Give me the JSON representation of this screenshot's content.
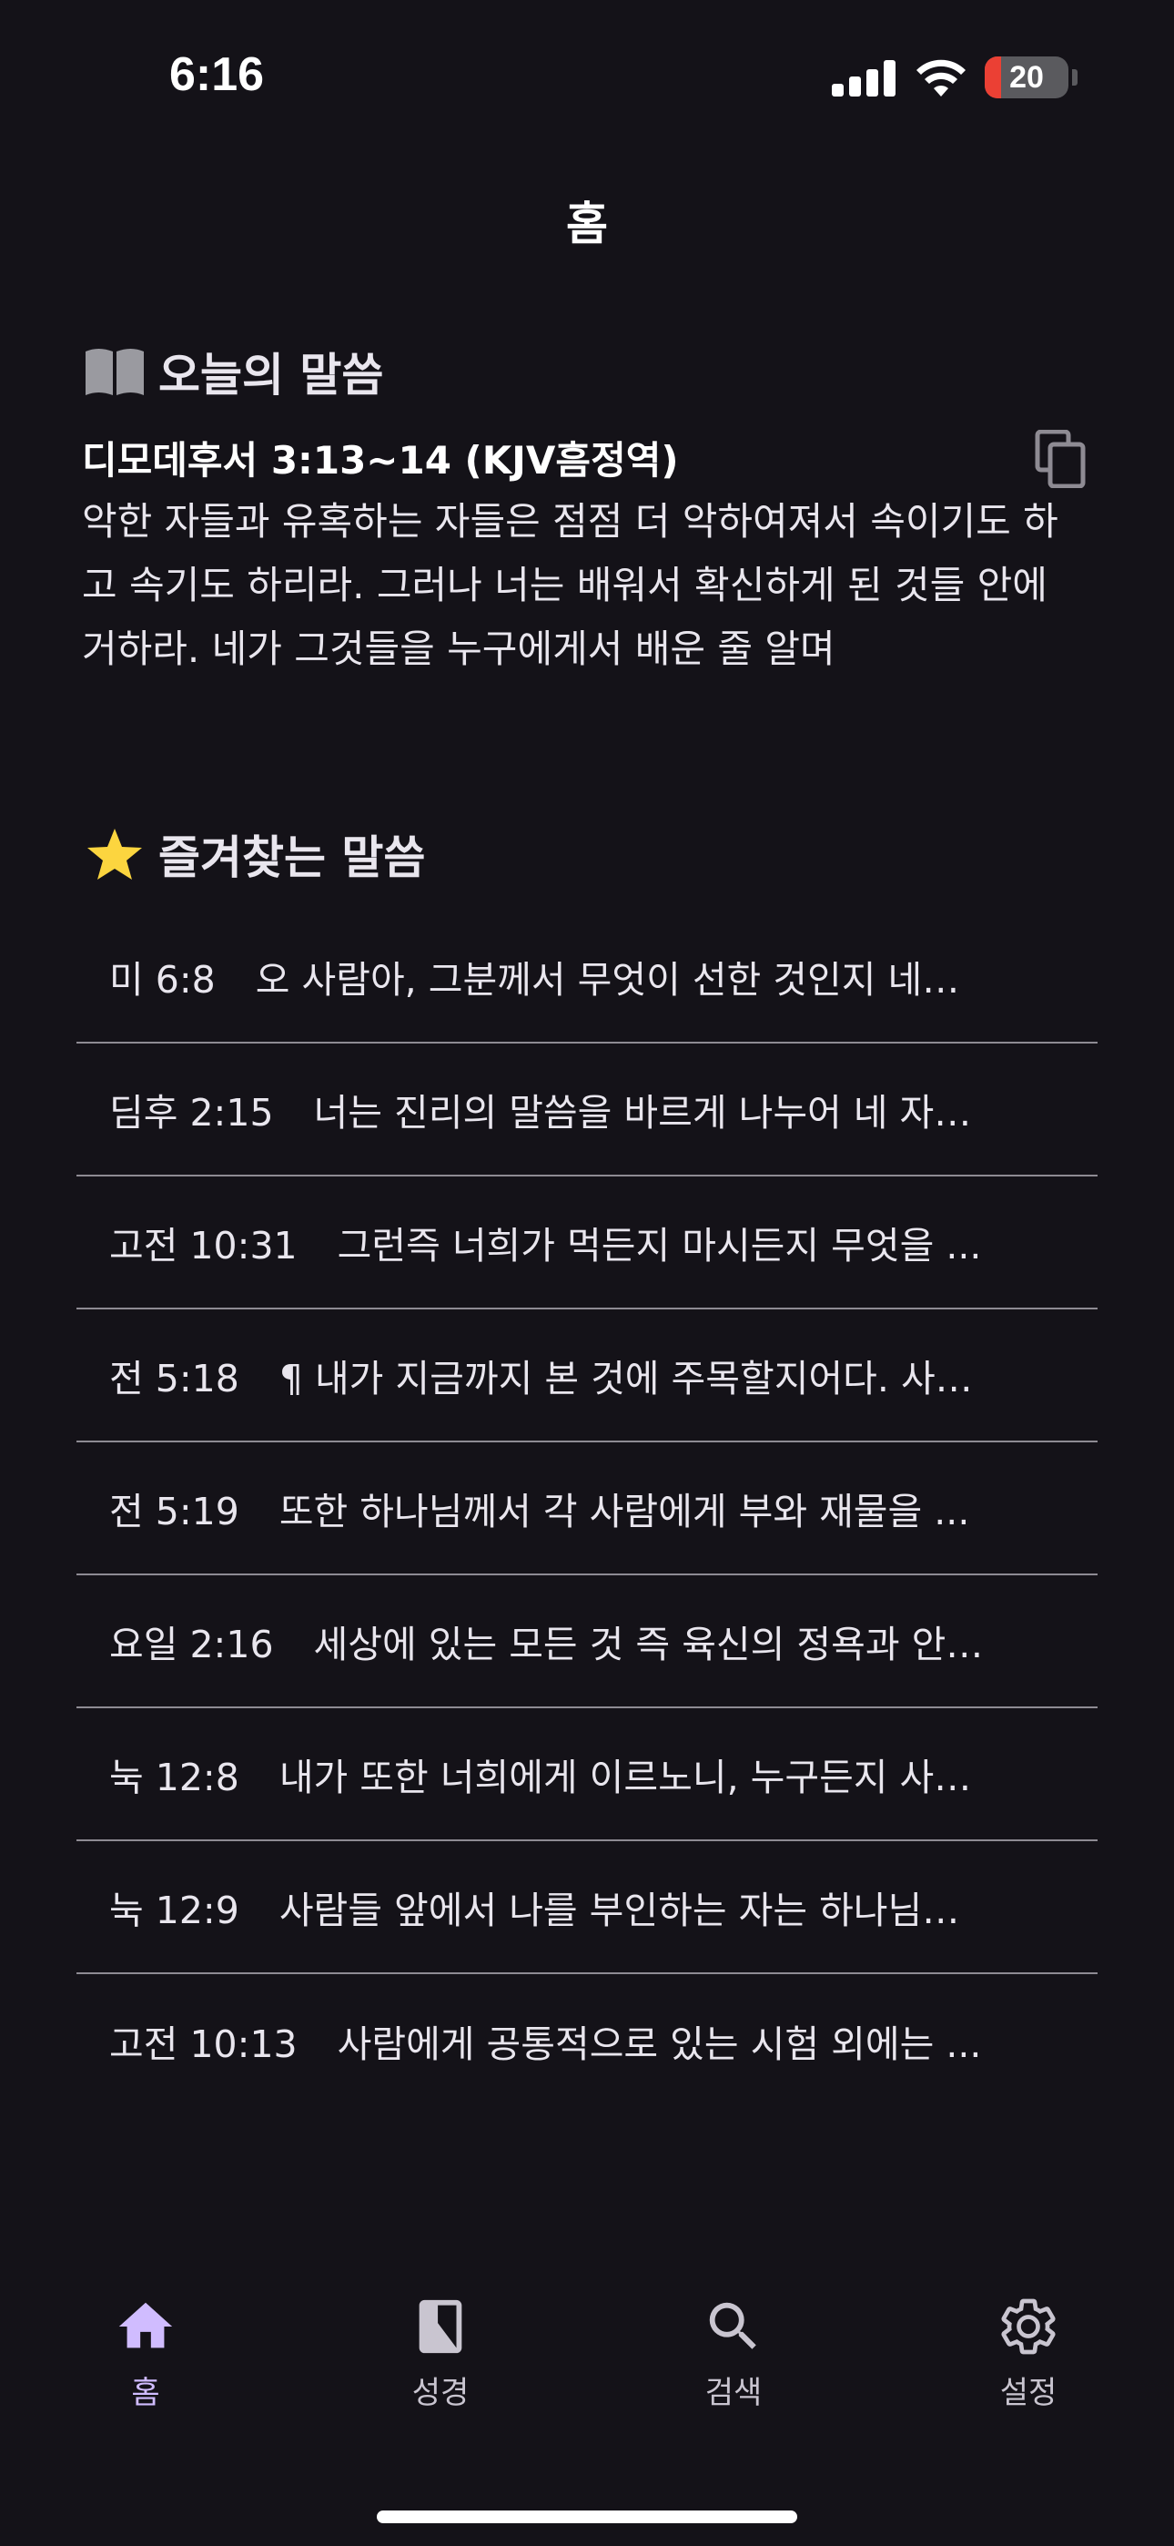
{
  "status": {
    "time": "6:16",
    "battery": "20",
    "battery_level": 0.2
  },
  "header": {
    "title": "홈"
  },
  "today": {
    "title": "오늘의 말씀",
    "reference": "디모데후서 3:13~14 (KJV흠정역)",
    "text": "악한 자들과 유혹하는 자들은 점점 더 악하여져서 속이기도 하고 속기도 하리라. 그러나 너는 배워서 확신하게 된 것들 안에 거하라. 네가 그것들을 누구에게서 배운 줄 알며"
  },
  "favorites": {
    "title": "즐겨찾는 말씀",
    "items": [
      {
        "ref": "미 6:8",
        "text": "오 사람아, 그분께서 무엇이 선한 것인지 네…"
      },
      {
        "ref": "딤후 2:15",
        "text": "너는 진리의 말씀을 바르게 나누어 네 자…"
      },
      {
        "ref": "고전 10:31",
        "text": "그런즉 너희가 먹든지 마시든지 무엇을 ..."
      },
      {
        "ref": "전 5:18",
        "text": "¶ 내가 지금까지 본 것에 주목할지어다. 사…"
      },
      {
        "ref": "전 5:19",
        "text": "또한 하나님께서 각 사람에게 부와 재물을 ..."
      },
      {
        "ref": "요일 2:16",
        "text": "세상에 있는 모든 것 즉 육신의 정욕과 안…"
      },
      {
        "ref": "눅 12:8",
        "text": "내가 또한 너희에게 이르노니, 누구든지 사…"
      },
      {
        "ref": "눅 12:9",
        "text": "사람들 앞에서 나를 부인하는 자는 하나님…"
      },
      {
        "ref": "고전 10:13",
        "text": "사람에게 공통적으로 있는 시험 외에는 ..."
      }
    ]
  },
  "nav": {
    "home": "홈",
    "bible": "성경",
    "search": "검색",
    "settings": "설정"
  },
  "colors": {
    "background": "#141218",
    "accent": "#d0bcff",
    "star": "#fcd53f"
  },
  "icons": {
    "today": "open-book-icon",
    "favorites": "star-icon",
    "copy": "copy-icon"
  }
}
